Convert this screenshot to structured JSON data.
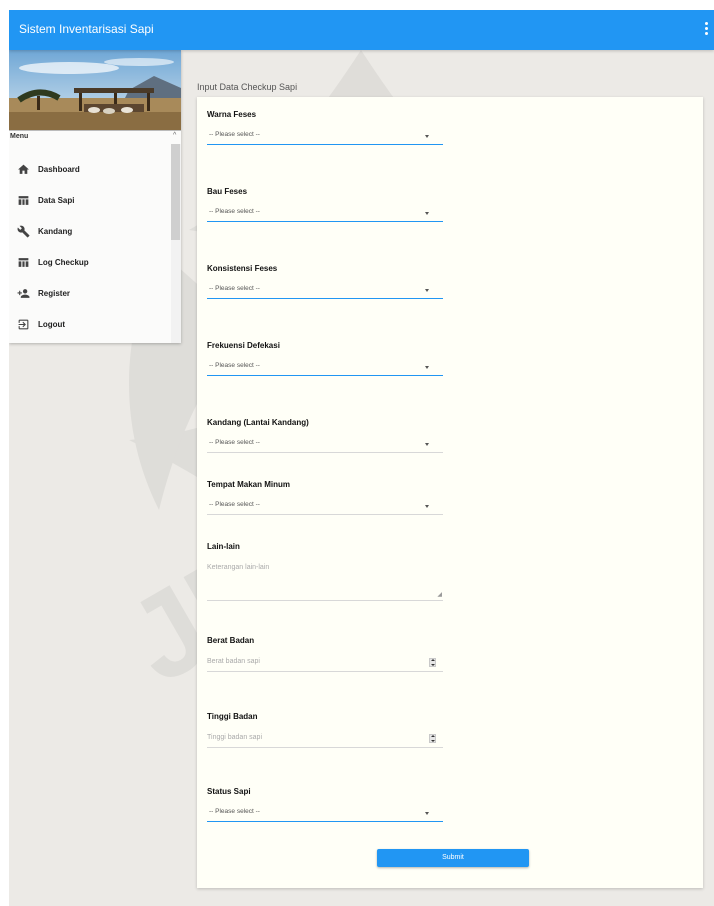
{
  "app": {
    "title": "Sistem Inventarisasi Sapi",
    "menu_icon": "more-vert-icon",
    "accent": "#2196f3"
  },
  "drawer": {
    "hero_image": "cattle-shelter-landscape",
    "menu_label": "Menu",
    "items": [
      {
        "label": "Dashboard",
        "icon": "home-icon"
      },
      {
        "label": "Data Sapi",
        "icon": "table-icon"
      },
      {
        "label": "Kandang",
        "icon": "wrench-icon"
      },
      {
        "label": "Log Checkup",
        "icon": "table-icon"
      },
      {
        "label": "Register",
        "icon": "person-add-icon"
      },
      {
        "label": "Logout",
        "icon": "logout-icon"
      }
    ]
  },
  "page": {
    "title": "Input Data Checkup Sapi"
  },
  "form": {
    "warna_feses": {
      "label": "Warna Feses",
      "value": "-- Please select --"
    },
    "bau_feses": {
      "label": "Bau Feses",
      "value": "-- Please select --"
    },
    "konsistensi_feses": {
      "label": "Konsistensi Feses",
      "value": "-- Please select --"
    },
    "frekuensi_defekasi": {
      "label": "Frekuensi Defekasi",
      "value": "-- Please select --"
    },
    "kandang": {
      "label": "Kandang (Lantai Kandang)",
      "value": "-- Please select --"
    },
    "tempat_makan": {
      "label": "Tempat Makan Minum",
      "value": "-- Please select --"
    },
    "lain_lain": {
      "label": "Lain-lain",
      "placeholder": "Keterangan lain-lain"
    },
    "berat_badan": {
      "label": "Berat Badan",
      "placeholder": "Berat badan sapi"
    },
    "tinggi_badan": {
      "label": "Tinggi Badan",
      "placeholder": "Tinggi badan sapi"
    },
    "status_sapi": {
      "label": "Status Sapi",
      "value": "-- Please select --"
    },
    "submit_label": "Submit"
  },
  "watermark": {
    "text": "JEMBER"
  }
}
